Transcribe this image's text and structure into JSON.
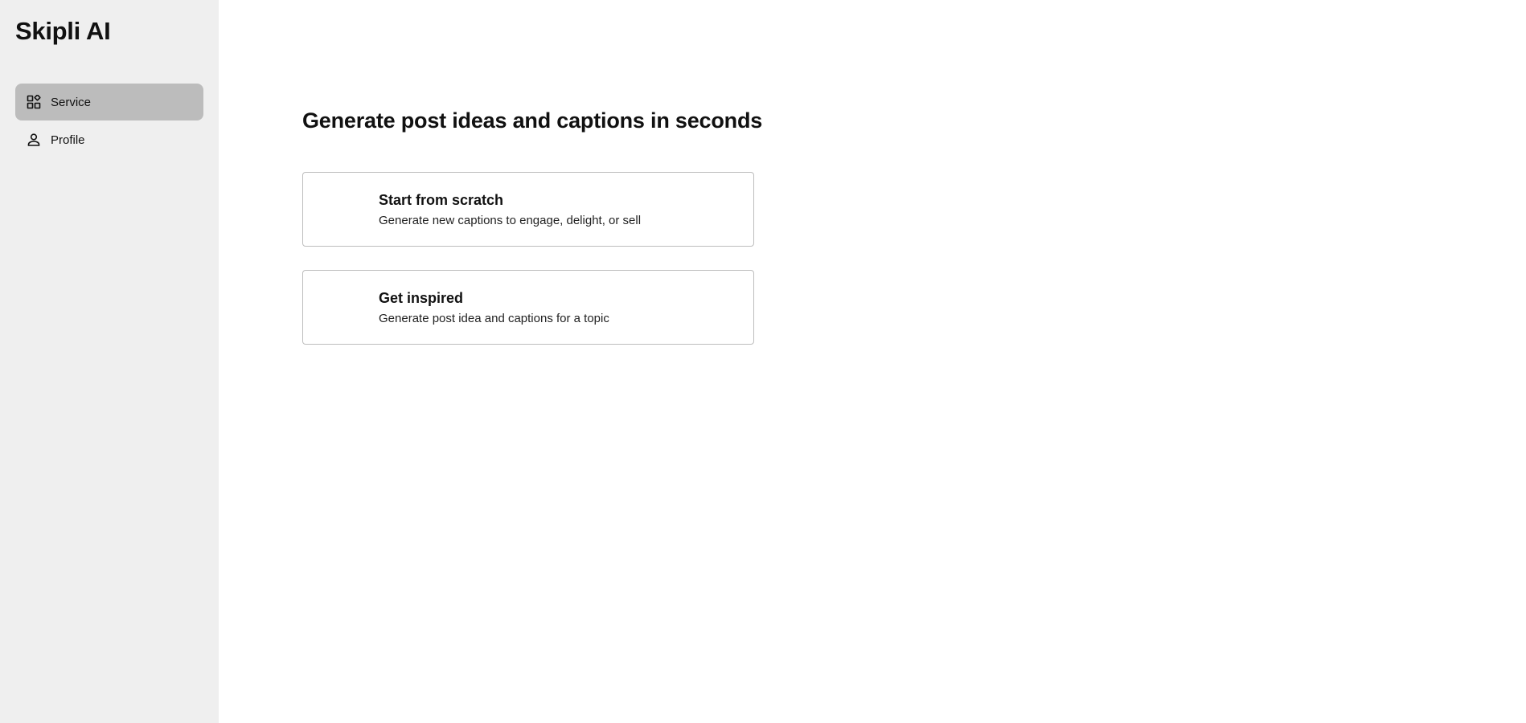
{
  "app": {
    "brand": "Skipli AI"
  },
  "sidebar": {
    "items": [
      {
        "label": "Service",
        "icon": "dashboard-icon",
        "active": true
      },
      {
        "label": "Profile",
        "icon": "person-icon",
        "active": false
      }
    ]
  },
  "main": {
    "title": "Generate post ideas and captions in seconds",
    "cards": [
      {
        "title": "Start from scratch",
        "description": "Generate new captions to engage, delight, or sell"
      },
      {
        "title": "Get inspired",
        "description": "Generate post idea and captions for a topic"
      }
    ]
  },
  "colors": {
    "sidebar_bg": "#efefef",
    "active_item_bg": "#bcbcbc",
    "card_border": "#bdbdbd"
  }
}
